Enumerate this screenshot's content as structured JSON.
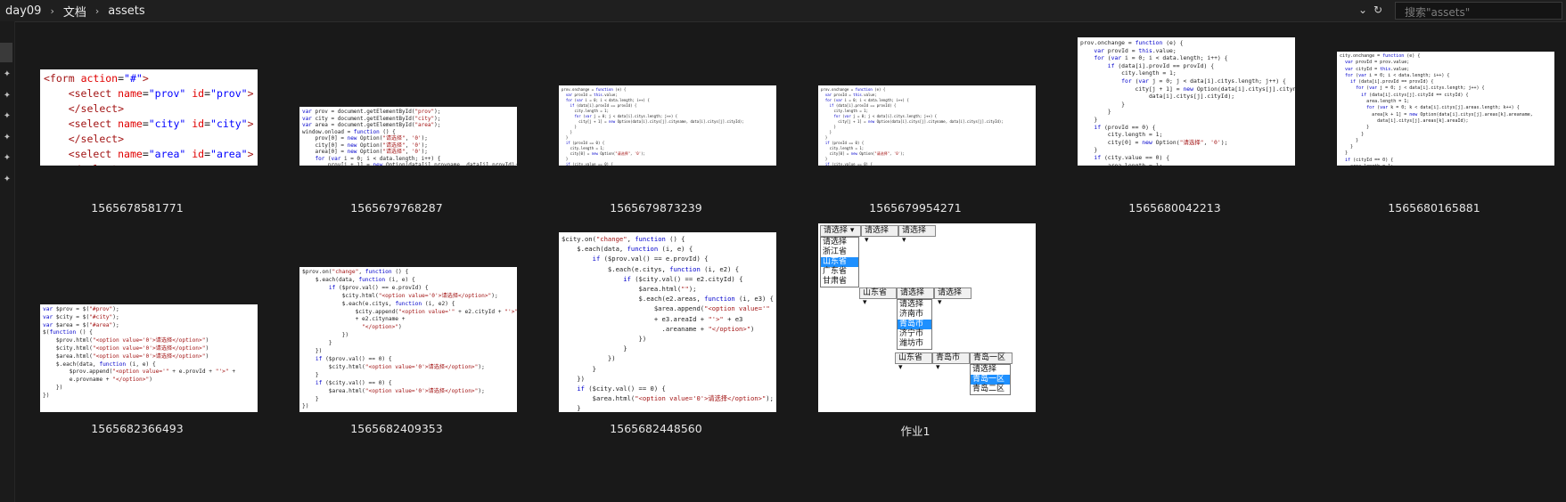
{
  "breadcrumb": [
    "day09",
    "文档",
    "assets"
  ],
  "search": {
    "placeholder": "搜索\"assets\""
  },
  "files": [
    {
      "name": "1565678581771"
    },
    {
      "name": "1565679768287"
    },
    {
      "name": "1565679873239"
    },
    {
      "name": "1565679954271"
    },
    {
      "name": "1565680042213"
    },
    {
      "name": "1565680165881"
    },
    {
      "name": "1565682366493"
    },
    {
      "name": "1565682409353"
    },
    {
      "name": "1565682448560"
    },
    {
      "name": "作业1"
    }
  ],
  "demo": {
    "prompt": "请选择",
    "provinces": [
      "请选择",
      "浙江省",
      "山东省",
      "广东省",
      "甘肃省"
    ],
    "cities": [
      "请选择",
      "济南市",
      "青岛市",
      "济宁市",
      "潍坊市"
    ],
    "areas": [
      "请选择",
      "青岛一区",
      "青岛二区"
    ],
    "selected_province": "山东省",
    "selected_city": "青岛市",
    "selected_area": "青岛一区"
  }
}
